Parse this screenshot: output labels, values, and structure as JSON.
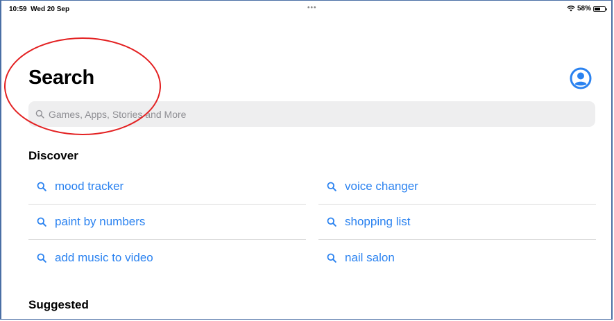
{
  "status_bar": {
    "time": "10:59",
    "date": "Wed 20 Sep",
    "dots": "•••",
    "battery": "58%"
  },
  "page": {
    "title": "Search"
  },
  "search": {
    "placeholder": "Games, Apps, Stories and More",
    "value": ""
  },
  "discover": {
    "title": "Discover",
    "items": [
      {
        "label": "mood tracker",
        "icon": "search-icon"
      },
      {
        "label": "voice changer",
        "icon": "search-icon"
      },
      {
        "label": "paint by numbers",
        "icon": "search-icon"
      },
      {
        "label": "shopping list",
        "icon": "search-icon"
      },
      {
        "label": "add music to video",
        "icon": "search-icon"
      },
      {
        "label": "nail salon",
        "icon": "search-icon"
      }
    ]
  },
  "suggested": {
    "title": "Suggested"
  },
  "colors": {
    "accent": "#2a82f0",
    "annotation": "#e32021",
    "search_bg": "#eeeeef"
  }
}
